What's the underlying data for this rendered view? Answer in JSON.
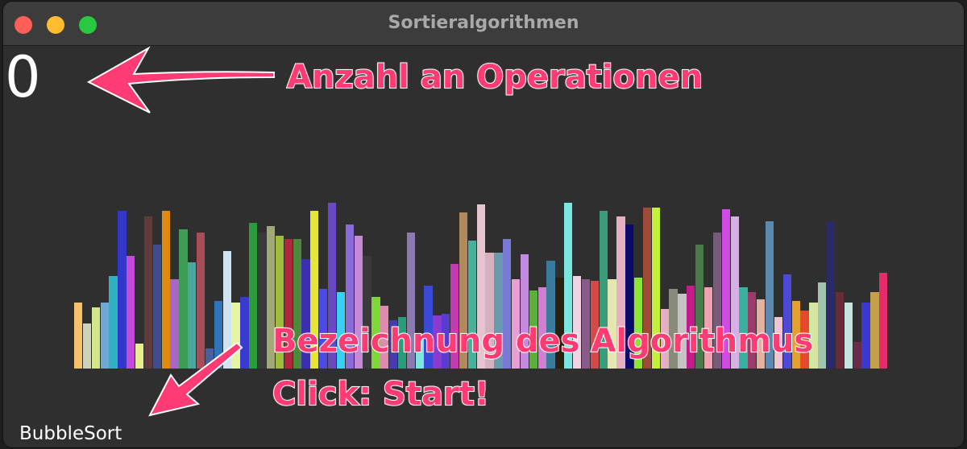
{
  "window": {
    "title": "Sortieralgorithmen"
  },
  "app": {
    "operation_count": "0",
    "algorithm_name": "BubbleSort"
  },
  "annotations": {
    "operations_label": "Anzahl an Operationen",
    "algorithm_label": "Bezeichnung des Algorithmus",
    "click_label": "Click: Start!"
  },
  "colors": {
    "background": "#2f2f2f",
    "annotation": "#ff3b73",
    "traffic_red": "#ff5f57",
    "traffic_yellow": "#febc2e",
    "traffic_green": "#28c840"
  },
  "chart_data": {
    "type": "bar",
    "values": [
      40,
      27,
      37,
      40,
      56,
      95,
      68,
      15,
      92,
      75,
      95,
      54,
      84,
      64,
      82,
      12,
      41,
      71,
      40,
      43,
      88,
      82,
      86,
      80,
      78,
      78,
      66,
      95,
      48,
      100,
      46,
      87,
      80,
      68,
      43,
      38,
      29,
      31,
      82,
      19,
      50,
      32,
      33,
      63,
      94,
      77,
      99,
      70,
      70,
      78,
      54,
      69,
      47,
      49,
      65,
      55,
      100,
      56,
      54,
      53,
      95,
      54,
      92,
      87,
      55,
      97,
      97,
      36,
      48,
      45,
      50,
      75,
      49,
      82,
      96,
      92,
      49,
      46,
      42,
      89,
      31,
      57,
      41,
      35,
      40,
      52,
      89,
      46,
      40,
      16,
      40,
      46,
      58
    ],
    "colors": [
      "#f5c26b",
      "#cfd3b7",
      "#d4e68c",
      "#6ea9d6",
      "#2fb3c4",
      "#3337cc",
      "#c44bd9",
      "#e6f08f",
      "#5f3c3a",
      "#3f4d8c",
      "#e08a10",
      "#a966c4",
      "#3e9c54",
      "#4aa8a0",
      "#a84c5a",
      "#4b5fa0",
      "#2f73bd",
      "#d0e3f0",
      "#e6f5a3",
      "#3a3ad0",
      "#2a9c3a",
      "#3a3a3a",
      "#a2a87a",
      "#9fbd3a",
      "#b0263a",
      "#4a8a3a",
      "#3b2fb0",
      "#e6e63a",
      "#4a4ae6",
      "#6a4ac4",
      "#3ad0f0",
      "#8a6ad6",
      "#c48ad6",
      "#3a3a3a",
      "#7ed63a",
      "#e08ab0",
      "#4a3ab0",
      "#2a9c7a",
      "#8a7ab0",
      "#7ae6e0",
      "#3a4ad6",
      "#8a3ad0",
      "#5a3ad0",
      "#c43ab0",
      "#b08a5a",
      "#4ab09c",
      "#e6c4d0",
      "#d4b0c0",
      "#6a9ab0",
      "#7a7ad6",
      "#e6a0d6",
      "#c48ae0",
      "#5ab03a",
      "#d080d0",
      "#3a7a9c",
      "#2a2010",
      "#7ae6e0",
      "#f0d4e6",
      "#8a5a8a",
      "#d44a4a",
      "#3a9c7a",
      "#e6e6b0",
      "#e6b0c4",
      "#0a0a6a",
      "#8ae63a",
      "#a04a3a",
      "#c4f03a",
      "#e6b0c4",
      "#8a8a7a",
      "#c4c4c4",
      "#c41a8a",
      "#4a7a4a",
      "#f0a0b0",
      "#7a5a7a",
      "#d04ae6",
      "#d4b0e6",
      "#3ab0a0",
      "#9c3a6a",
      "#e6b0a0",
      "#5a8ab0",
      "#f0c4d6",
      "#4a4ad6",
      "#e6a030",
      "#e64a2a",
      "#d4e6a0",
      "#a0c4b0",
      "#2a2a6a",
      "#6a2a3a",
      "#c4e6e0",
      "#6a2a4a",
      "#3a3ad0",
      "#c4a04a",
      "#e62a6a"
    ]
  }
}
